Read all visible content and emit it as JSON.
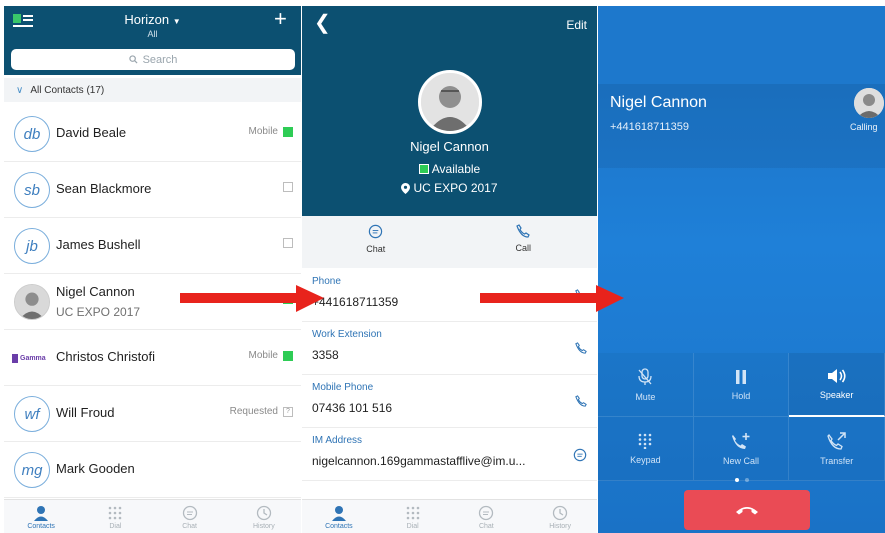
{
  "contacts_panel": {
    "brand": "Horizon",
    "brand_sub": "All",
    "search_placeholder": "Search",
    "section_title": "All Contacts (17)",
    "contacts": [
      {
        "initials": "db",
        "name": "David Beale",
        "sub": "",
        "status_text": "Mobile",
        "status": "available"
      },
      {
        "initials": "sb",
        "name": "Sean Blackmore",
        "sub": "",
        "status_text": "",
        "status": "offline"
      },
      {
        "initials": "jb",
        "name": "James Bushell",
        "sub": "",
        "status_text": "",
        "status": "offline"
      },
      {
        "initials": "",
        "name": "Nigel Cannon",
        "sub": "UC EXPO 2017",
        "status_text": "",
        "status": "available"
      },
      {
        "initials": "Gamma",
        "name": "Christos Christofi",
        "sub": "",
        "status_text": "Mobile",
        "status": "available"
      },
      {
        "initials": "wf",
        "name": "Will Froud",
        "sub": "",
        "status_text": "Requested",
        "status": "requested"
      },
      {
        "initials": "mg",
        "name": "Mark Gooden",
        "sub": "",
        "status_text": "",
        "status": "none"
      }
    ],
    "tabs": [
      {
        "label": "Contacts",
        "active": true
      },
      {
        "label": "Dial",
        "active": false
      },
      {
        "label": "Chat",
        "active": false
      },
      {
        "label": "History",
        "active": false
      }
    ]
  },
  "detail_panel": {
    "edit_label": "Edit",
    "name": "Nigel Cannon",
    "availability": "Available",
    "location": "UC EXPO 2017",
    "actions": [
      {
        "label": "Chat"
      },
      {
        "label": "Call"
      }
    ],
    "fields": [
      {
        "label": "Phone",
        "value": "+441618711359",
        "icon": "phone-icon"
      },
      {
        "label": "Work Extension",
        "value": "3358",
        "icon": "phone-icon"
      },
      {
        "label": "Mobile Phone",
        "value": "07436 101 516",
        "icon": "phone-icon"
      },
      {
        "label": "IM Address",
        "value": "nigelcannon.169gammastafflive@im.u...",
        "icon": "chat-icon"
      }
    ],
    "tabs": [
      {
        "label": "Contacts",
        "active": true
      },
      {
        "label": "Dial",
        "active": false
      },
      {
        "label": "Chat",
        "active": false
      },
      {
        "label": "History",
        "active": false
      }
    ]
  },
  "call_panel": {
    "name": "Nigel Cannon",
    "number": "+441618711359",
    "state": "Calling",
    "controls": [
      {
        "label": "Mute",
        "icon": "mic-off-icon",
        "active": false
      },
      {
        "label": "Hold",
        "icon": "pause-icon",
        "active": false
      },
      {
        "label": "Speaker",
        "icon": "speaker-icon",
        "active": true
      },
      {
        "label": "Keypad",
        "icon": "keypad-icon",
        "active": false
      },
      {
        "label": "New Call",
        "icon": "new-call-icon",
        "active": false
      },
      {
        "label": "Transfer",
        "icon": "transfer-icon",
        "active": false
      }
    ]
  },
  "colors": {
    "header_blue": "#0c5071",
    "call_blue": "#1f80d8",
    "available_green": "#2ecc55",
    "link_blue": "#2f74b5",
    "hangup_red": "#ea4b55",
    "arrow_red": "#e8231c"
  }
}
